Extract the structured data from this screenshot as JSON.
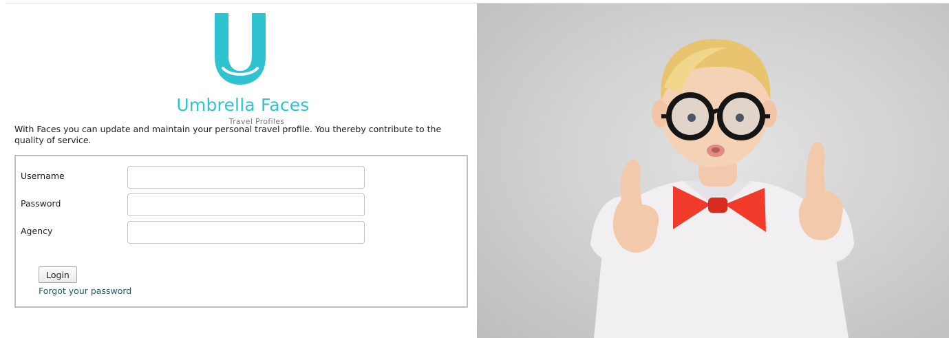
{
  "brand": {
    "name": "Umbrella Faces",
    "tagline": "Travel Profiles",
    "accent_color": "#2ec3cf"
  },
  "intro_text": "With Faces you can update and maintain your personal travel profile. You thereby contribute to the quality of service.",
  "login_form": {
    "username_label": "Username",
    "username_value": "",
    "password_label": "Password",
    "password_value": "",
    "agency_label": "Agency",
    "agency_value": "",
    "login_button": "Login",
    "forgot_link": "Forgot your password"
  },
  "hero_image": {
    "subject": "child-with-glasses-and-bowtie-thumbs-up"
  }
}
